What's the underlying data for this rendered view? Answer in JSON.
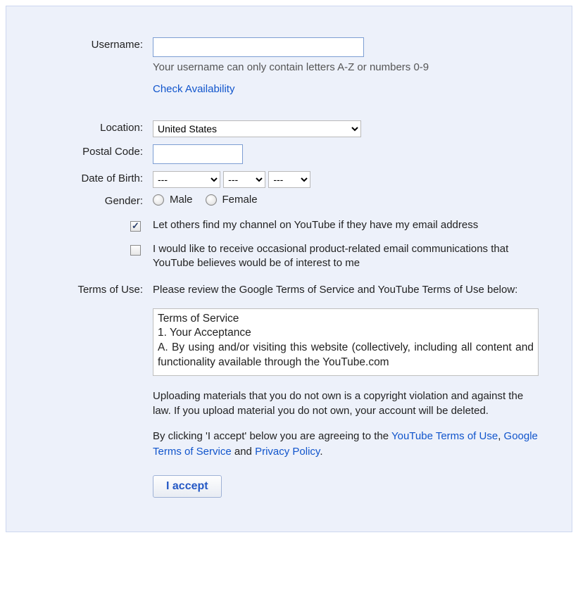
{
  "labels": {
    "username": "Username:",
    "location": "Location:",
    "postal": "Postal Code:",
    "dob": "Date of Birth:",
    "gender": "Gender:",
    "terms": "Terms of Use:"
  },
  "username": {
    "value": "",
    "hint": "Your username can only contain letters A-Z or numbers 0-9",
    "check_link": "Check Availability"
  },
  "location": {
    "selected": "United States"
  },
  "postal": {
    "value": ""
  },
  "dob": {
    "month": "---",
    "day": "---",
    "year": "---"
  },
  "gender": {
    "male": "Male",
    "female": "Female"
  },
  "checks": {
    "find_channel": "Let others find my channel on YouTube if they have my email address",
    "emails": "I would like to receive occasional product-related email communications that YouTube believes would be of interest to me"
  },
  "terms": {
    "intro": "Please review the Google Terms of Service and YouTube Terms of Use below:",
    "body": "Terms of Service\n1. Your Acceptance\nA. By using and/or visiting this website (collectively, including all content and functionality available through the YouTube.com",
    "upload_warning": "Uploading materials that you do not own is a copyright violation and against the law. If you upload material you do not own, your account will be deleted.",
    "agree_prefix": "By clicking 'I accept' below you are agreeing to the ",
    "link1": "YouTube Terms of Use",
    "sep1": ", ",
    "link2": "Google Terms of Service",
    "sep2": " and ",
    "link3": "Privacy Policy",
    "suffix": "."
  },
  "buttons": {
    "accept": "I accept"
  }
}
